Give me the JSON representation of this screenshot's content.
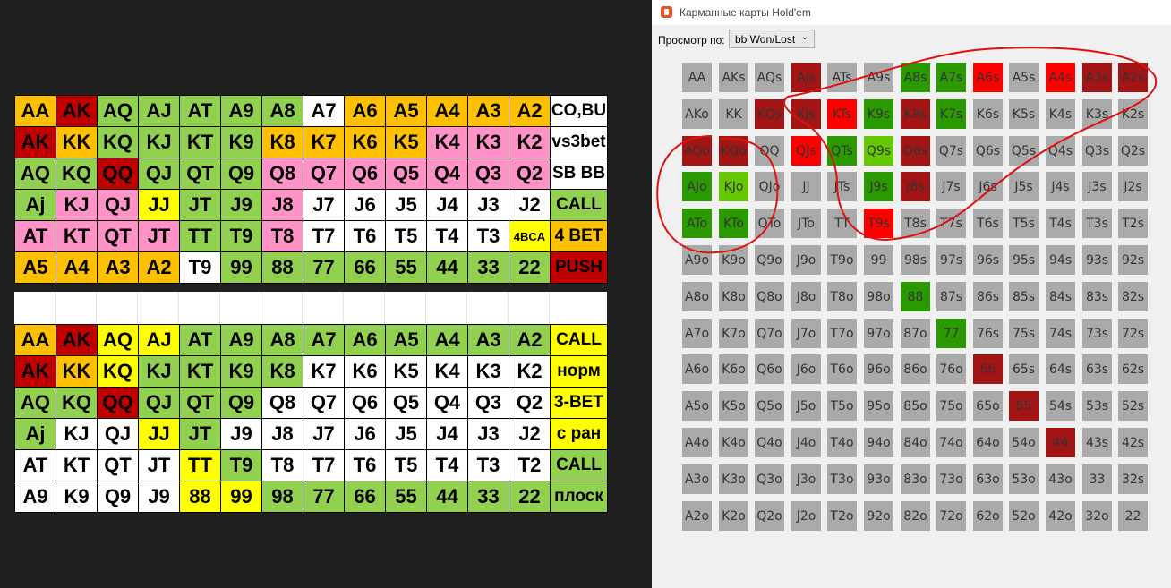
{
  "spreadsheet": {
    "top_rows": [
      [
        [
          "AA",
          "o"
        ],
        [
          "AK",
          "r"
        ],
        [
          "AQ",
          "g"
        ],
        [
          "AJ",
          "g"
        ],
        [
          "AT",
          "g"
        ],
        [
          "A9",
          "g"
        ],
        [
          "A8",
          "g"
        ],
        [
          "A7",
          "w"
        ],
        [
          "A6",
          "o"
        ],
        [
          "A5",
          "o"
        ],
        [
          "A4",
          "o"
        ],
        [
          "A3",
          "o"
        ],
        [
          "A2",
          "o"
        ],
        [
          "CO,BU",
          "w"
        ]
      ],
      [
        [
          "AK",
          "r"
        ],
        [
          "KK",
          "o"
        ],
        [
          "KQ",
          "g"
        ],
        [
          "KJ",
          "g"
        ],
        [
          "KT",
          "g"
        ],
        [
          "K9",
          "g"
        ],
        [
          "K8",
          "o"
        ],
        [
          "K7",
          "o"
        ],
        [
          "K6",
          "o"
        ],
        [
          "K5",
          "o"
        ],
        [
          "K4",
          "p"
        ],
        [
          "K3",
          "p"
        ],
        [
          "K2",
          "p"
        ],
        [
          "vs3bet",
          "w"
        ]
      ],
      [
        [
          "AQ",
          "g"
        ],
        [
          "KQ",
          "g"
        ],
        [
          "QQ",
          "r"
        ],
        [
          "QJ",
          "g"
        ],
        [
          "QT",
          "g"
        ],
        [
          "Q9",
          "g"
        ],
        [
          "Q8",
          "p"
        ],
        [
          "Q7",
          "p"
        ],
        [
          "Q6",
          "p"
        ],
        [
          "Q5",
          "p"
        ],
        [
          "Q4",
          "p"
        ],
        [
          "Q3",
          "p"
        ],
        [
          "Q2",
          "p"
        ],
        [
          "SB BB",
          "w"
        ]
      ],
      [
        [
          "Aj",
          "g"
        ],
        [
          "KJ",
          "p"
        ],
        [
          "QJ",
          "p"
        ],
        [
          "JJ",
          "y"
        ],
        [
          "JT",
          "g"
        ],
        [
          "J9",
          "g"
        ],
        [
          "J8",
          "p"
        ],
        [
          "J7",
          "w"
        ],
        [
          "J6",
          "w"
        ],
        [
          "J5",
          "w"
        ],
        [
          "J4",
          "w"
        ],
        [
          "J3",
          "w"
        ],
        [
          "J2",
          "w"
        ],
        [
          "CALL",
          "g"
        ]
      ],
      [
        [
          "AT",
          "p"
        ],
        [
          "KT",
          "p"
        ],
        [
          "QT",
          "p"
        ],
        [
          "JT",
          "p"
        ],
        [
          "TT",
          "g"
        ],
        [
          "T9",
          "g"
        ],
        [
          "T8",
          "p"
        ],
        [
          "T7",
          "w"
        ],
        [
          "T6",
          "w"
        ],
        [
          "T5",
          "w"
        ],
        [
          "T4",
          "w"
        ],
        [
          "T3",
          "w"
        ],
        [
          "4BCA",
          "y"
        ],
        [
          "4 BET",
          "o"
        ]
      ],
      [
        [
          "A5",
          "o"
        ],
        [
          "A4",
          "o"
        ],
        [
          "A3",
          "o"
        ],
        [
          "A2",
          "o"
        ],
        [
          "T9",
          "w"
        ],
        [
          "99",
          "g"
        ],
        [
          "88",
          "g"
        ],
        [
          "77",
          "g"
        ],
        [
          "66",
          "g"
        ],
        [
          "55",
          "g"
        ],
        [
          "44",
          "g"
        ],
        [
          "33",
          "g"
        ],
        [
          "22",
          "g"
        ],
        [
          "PUSH",
          "r"
        ]
      ]
    ],
    "bottom_rows": [
      [
        [
          "AA",
          "o"
        ],
        [
          "AK",
          "r"
        ],
        [
          "AQ",
          "y"
        ],
        [
          "AJ",
          "y"
        ],
        [
          "AT",
          "g"
        ],
        [
          "A9",
          "g"
        ],
        [
          "A8",
          "g"
        ],
        [
          "A7",
          "g"
        ],
        [
          "A6",
          "g"
        ],
        [
          "A5",
          "g"
        ],
        [
          "A4",
          "g"
        ],
        [
          "A3",
          "g"
        ],
        [
          "A2",
          "g"
        ],
        [
          "CALL",
          "y"
        ]
      ],
      [
        [
          "AK",
          "r"
        ],
        [
          "KK",
          "o"
        ],
        [
          "KQ",
          "y"
        ],
        [
          "KJ",
          "g"
        ],
        [
          "KT",
          "g"
        ],
        [
          "K9",
          "g"
        ],
        [
          "K8",
          "g"
        ],
        [
          "K7",
          "w"
        ],
        [
          "K6",
          "w"
        ],
        [
          "K5",
          "w"
        ],
        [
          "K4",
          "w"
        ],
        [
          "K3",
          "w"
        ],
        [
          "K2",
          "w"
        ],
        [
          "норм",
          "y"
        ]
      ],
      [
        [
          "AQ",
          "g"
        ],
        [
          "KQ",
          "g"
        ],
        [
          "QQ",
          "r"
        ],
        [
          "QJ",
          "g"
        ],
        [
          "QT",
          "g"
        ],
        [
          "Q9",
          "g"
        ],
        [
          "Q8",
          "w"
        ],
        [
          "Q7",
          "w"
        ],
        [
          "Q6",
          "w"
        ],
        [
          "Q5",
          "w"
        ],
        [
          "Q4",
          "w"
        ],
        [
          "Q3",
          "w"
        ],
        [
          "Q2",
          "w"
        ],
        [
          "3-BET",
          "y"
        ]
      ],
      [
        [
          "Aj",
          "g"
        ],
        [
          "KJ",
          "w"
        ],
        [
          "QJ",
          "w"
        ],
        [
          "JJ",
          "y"
        ],
        [
          "JT",
          "g"
        ],
        [
          "J9",
          "w"
        ],
        [
          "J8",
          "w"
        ],
        [
          "J7",
          "w"
        ],
        [
          "J6",
          "w"
        ],
        [
          "J5",
          "w"
        ],
        [
          "J4",
          "w"
        ],
        [
          "J3",
          "w"
        ],
        [
          "J2",
          "w"
        ],
        [
          "с ран",
          "y"
        ]
      ],
      [
        [
          "AT",
          "w"
        ],
        [
          "KT",
          "w"
        ],
        [
          "QT",
          "w"
        ],
        [
          "JT",
          "w"
        ],
        [
          "TT",
          "y"
        ],
        [
          "T9",
          "g"
        ],
        [
          "T8",
          "w"
        ],
        [
          "T7",
          "w"
        ],
        [
          "T6",
          "w"
        ],
        [
          "T5",
          "w"
        ],
        [
          "T4",
          "w"
        ],
        [
          "T3",
          "w"
        ],
        [
          "T2",
          "w"
        ],
        [
          "CALL",
          "g"
        ]
      ],
      [
        [
          "A9",
          "w"
        ],
        [
          "K9",
          "w"
        ],
        [
          "Q9",
          "w"
        ],
        [
          "J9",
          "w"
        ],
        [
          "88",
          "y"
        ],
        [
          "99",
          "y"
        ],
        [
          "98",
          "g"
        ],
        [
          "77",
          "g"
        ],
        [
          "66",
          "g"
        ],
        [
          "55",
          "g"
        ],
        [
          "44",
          "g"
        ],
        [
          "33",
          "g"
        ],
        [
          "22",
          "g"
        ],
        [
          "плоск",
          "g"
        ]
      ]
    ]
  },
  "window": {
    "title": "Карманные карты Hold'em",
    "view_label": "Просмотр по:",
    "view_select_value": "bb Won/Lost"
  },
  "hand_grid": {
    "colors": {
      "n": "#aaaaaa",
      "dr": "#a31515",
      "r": "#ff0000",
      "g": "#2a9a00",
      "lg": "#66c800"
    },
    "rows": [
      [
        [
          "AA",
          "n"
        ],
        [
          "AKs",
          "n"
        ],
        [
          "AQs",
          "n"
        ],
        [
          "AJs",
          "dr"
        ],
        [
          "ATs",
          "n"
        ],
        [
          "A9s",
          "n"
        ],
        [
          "A8s",
          "g"
        ],
        [
          "A7s",
          "g"
        ],
        [
          "A6s",
          "r"
        ],
        [
          "A5s",
          "n"
        ],
        [
          "A4s",
          "r"
        ],
        [
          "A3s",
          "dr"
        ],
        [
          "A2s",
          "dr"
        ]
      ],
      [
        [
          "AKo",
          "n"
        ],
        [
          "KK",
          "n"
        ],
        [
          "KQs",
          "dr"
        ],
        [
          "KJs",
          "dr"
        ],
        [
          "KTs",
          "r"
        ],
        [
          "K9s",
          "g"
        ],
        [
          "K8s",
          "dr"
        ],
        [
          "K7s",
          "g"
        ],
        [
          "K6s",
          "n"
        ],
        [
          "K5s",
          "n"
        ],
        [
          "K4s",
          "n"
        ],
        [
          "K3s",
          "n"
        ],
        [
          "K2s",
          "n"
        ]
      ],
      [
        [
          "AQo",
          "dr"
        ],
        [
          "KQo",
          "dr"
        ],
        [
          "QQ",
          "n"
        ],
        [
          "QJs",
          "r"
        ],
        [
          "QTs",
          "g"
        ],
        [
          "Q9s",
          "lg"
        ],
        [
          "Q8s",
          "dr"
        ],
        [
          "Q7s",
          "n"
        ],
        [
          "Q6s",
          "n"
        ],
        [
          "Q5s",
          "n"
        ],
        [
          "Q4s",
          "n"
        ],
        [
          "Q3s",
          "n"
        ],
        [
          "Q2s",
          "n"
        ]
      ],
      [
        [
          "AJo",
          "g"
        ],
        [
          "KJo",
          "lg"
        ],
        [
          "QJo",
          "n"
        ],
        [
          "JJ",
          "n"
        ],
        [
          "JTs",
          "n"
        ],
        [
          "J9s",
          "g"
        ],
        [
          "J8s",
          "dr"
        ],
        [
          "J7s",
          "n"
        ],
        [
          "J6s",
          "n"
        ],
        [
          "J5s",
          "n"
        ],
        [
          "J4s",
          "n"
        ],
        [
          "J3s",
          "n"
        ],
        [
          "J2s",
          "n"
        ]
      ],
      [
        [
          "ATo",
          "g"
        ],
        [
          "KTo",
          "g"
        ],
        [
          "QTo",
          "n"
        ],
        [
          "JTo",
          "n"
        ],
        [
          "TT",
          "n"
        ],
        [
          "T9s",
          "r"
        ],
        [
          "T8s",
          "n"
        ],
        [
          "T7s",
          "n"
        ],
        [
          "T6s",
          "n"
        ],
        [
          "T5s",
          "n"
        ],
        [
          "T4s",
          "n"
        ],
        [
          "T3s",
          "n"
        ],
        [
          "T2s",
          "n"
        ]
      ],
      [
        [
          "A9o",
          "n"
        ],
        [
          "K9o",
          "n"
        ],
        [
          "Q9o",
          "n"
        ],
        [
          "J9o",
          "n"
        ],
        [
          "T9o",
          "n"
        ],
        [
          "99",
          "n"
        ],
        [
          "98s",
          "n"
        ],
        [
          "97s",
          "n"
        ],
        [
          "96s",
          "n"
        ],
        [
          "95s",
          "n"
        ],
        [
          "94s",
          "n"
        ],
        [
          "93s",
          "n"
        ],
        [
          "92s",
          "n"
        ]
      ],
      [
        [
          "A8o",
          "n"
        ],
        [
          "K8o",
          "n"
        ],
        [
          "Q8o",
          "n"
        ],
        [
          "J8o",
          "n"
        ],
        [
          "T8o",
          "n"
        ],
        [
          "98o",
          "n"
        ],
        [
          "88",
          "g"
        ],
        [
          "87s",
          "n"
        ],
        [
          "86s",
          "n"
        ],
        [
          "85s",
          "n"
        ],
        [
          "84s",
          "n"
        ],
        [
          "83s",
          "n"
        ],
        [
          "82s",
          "n"
        ]
      ],
      [
        [
          "A7o",
          "n"
        ],
        [
          "K7o",
          "n"
        ],
        [
          "Q7o",
          "n"
        ],
        [
          "J7o",
          "n"
        ],
        [
          "T7o",
          "n"
        ],
        [
          "97o",
          "n"
        ],
        [
          "87o",
          "n"
        ],
        [
          "77",
          "g"
        ],
        [
          "76s",
          "n"
        ],
        [
          "75s",
          "n"
        ],
        [
          "74s",
          "n"
        ],
        [
          "73s",
          "n"
        ],
        [
          "72s",
          "n"
        ]
      ],
      [
        [
          "A6o",
          "n"
        ],
        [
          "K6o",
          "n"
        ],
        [
          "Q6o",
          "n"
        ],
        [
          "J6o",
          "n"
        ],
        [
          "T6o",
          "n"
        ],
        [
          "96o",
          "n"
        ],
        [
          "86o",
          "n"
        ],
        [
          "76o",
          "n"
        ],
        [
          "66",
          "dr"
        ],
        [
          "65s",
          "n"
        ],
        [
          "64s",
          "n"
        ],
        [
          "63s",
          "n"
        ],
        [
          "62s",
          "n"
        ]
      ],
      [
        [
          "A5o",
          "n"
        ],
        [
          "K5o",
          "n"
        ],
        [
          "Q5o",
          "n"
        ],
        [
          "J5o",
          "n"
        ],
        [
          "T5o",
          "n"
        ],
        [
          "95o",
          "n"
        ],
        [
          "85o",
          "n"
        ],
        [
          "75o",
          "n"
        ],
        [
          "65o",
          "n"
        ],
        [
          "55",
          "dr"
        ],
        [
          "54s",
          "n"
        ],
        [
          "53s",
          "n"
        ],
        [
          "52s",
          "n"
        ]
      ],
      [
        [
          "A4o",
          "n"
        ],
        [
          "K4o",
          "n"
        ],
        [
          "Q4o",
          "n"
        ],
        [
          "J4o",
          "n"
        ],
        [
          "T4o",
          "n"
        ],
        [
          "94o",
          "n"
        ],
        [
          "84o",
          "n"
        ],
        [
          "74o",
          "n"
        ],
        [
          "64o",
          "n"
        ],
        [
          "54o",
          "n"
        ],
        [
          "44",
          "dr"
        ],
        [
          "43s",
          "n"
        ],
        [
          "42s",
          "n"
        ]
      ],
      [
        [
          "A3o",
          "n"
        ],
        [
          "K3o",
          "n"
        ],
        [
          "Q3o",
          "n"
        ],
        [
          "J3o",
          "n"
        ],
        [
          "T3o",
          "n"
        ],
        [
          "93o",
          "n"
        ],
        [
          "83o",
          "n"
        ],
        [
          "73o",
          "n"
        ],
        [
          "63o",
          "n"
        ],
        [
          "53o",
          "n"
        ],
        [
          "43o",
          "n"
        ],
        [
          "33",
          "n"
        ],
        [
          "32s",
          "n"
        ]
      ],
      [
        [
          "A2o",
          "n"
        ],
        [
          "K2o",
          "n"
        ],
        [
          "Q2o",
          "n"
        ],
        [
          "J2o",
          "n"
        ],
        [
          "T2o",
          "n"
        ],
        [
          "92o",
          "n"
        ],
        [
          "82o",
          "n"
        ],
        [
          "72o",
          "n"
        ],
        [
          "62o",
          "n"
        ],
        [
          "52o",
          "n"
        ],
        [
          "42o",
          "n"
        ],
        [
          "32o",
          "n"
        ],
        [
          "22",
          "n"
        ]
      ]
    ]
  }
}
